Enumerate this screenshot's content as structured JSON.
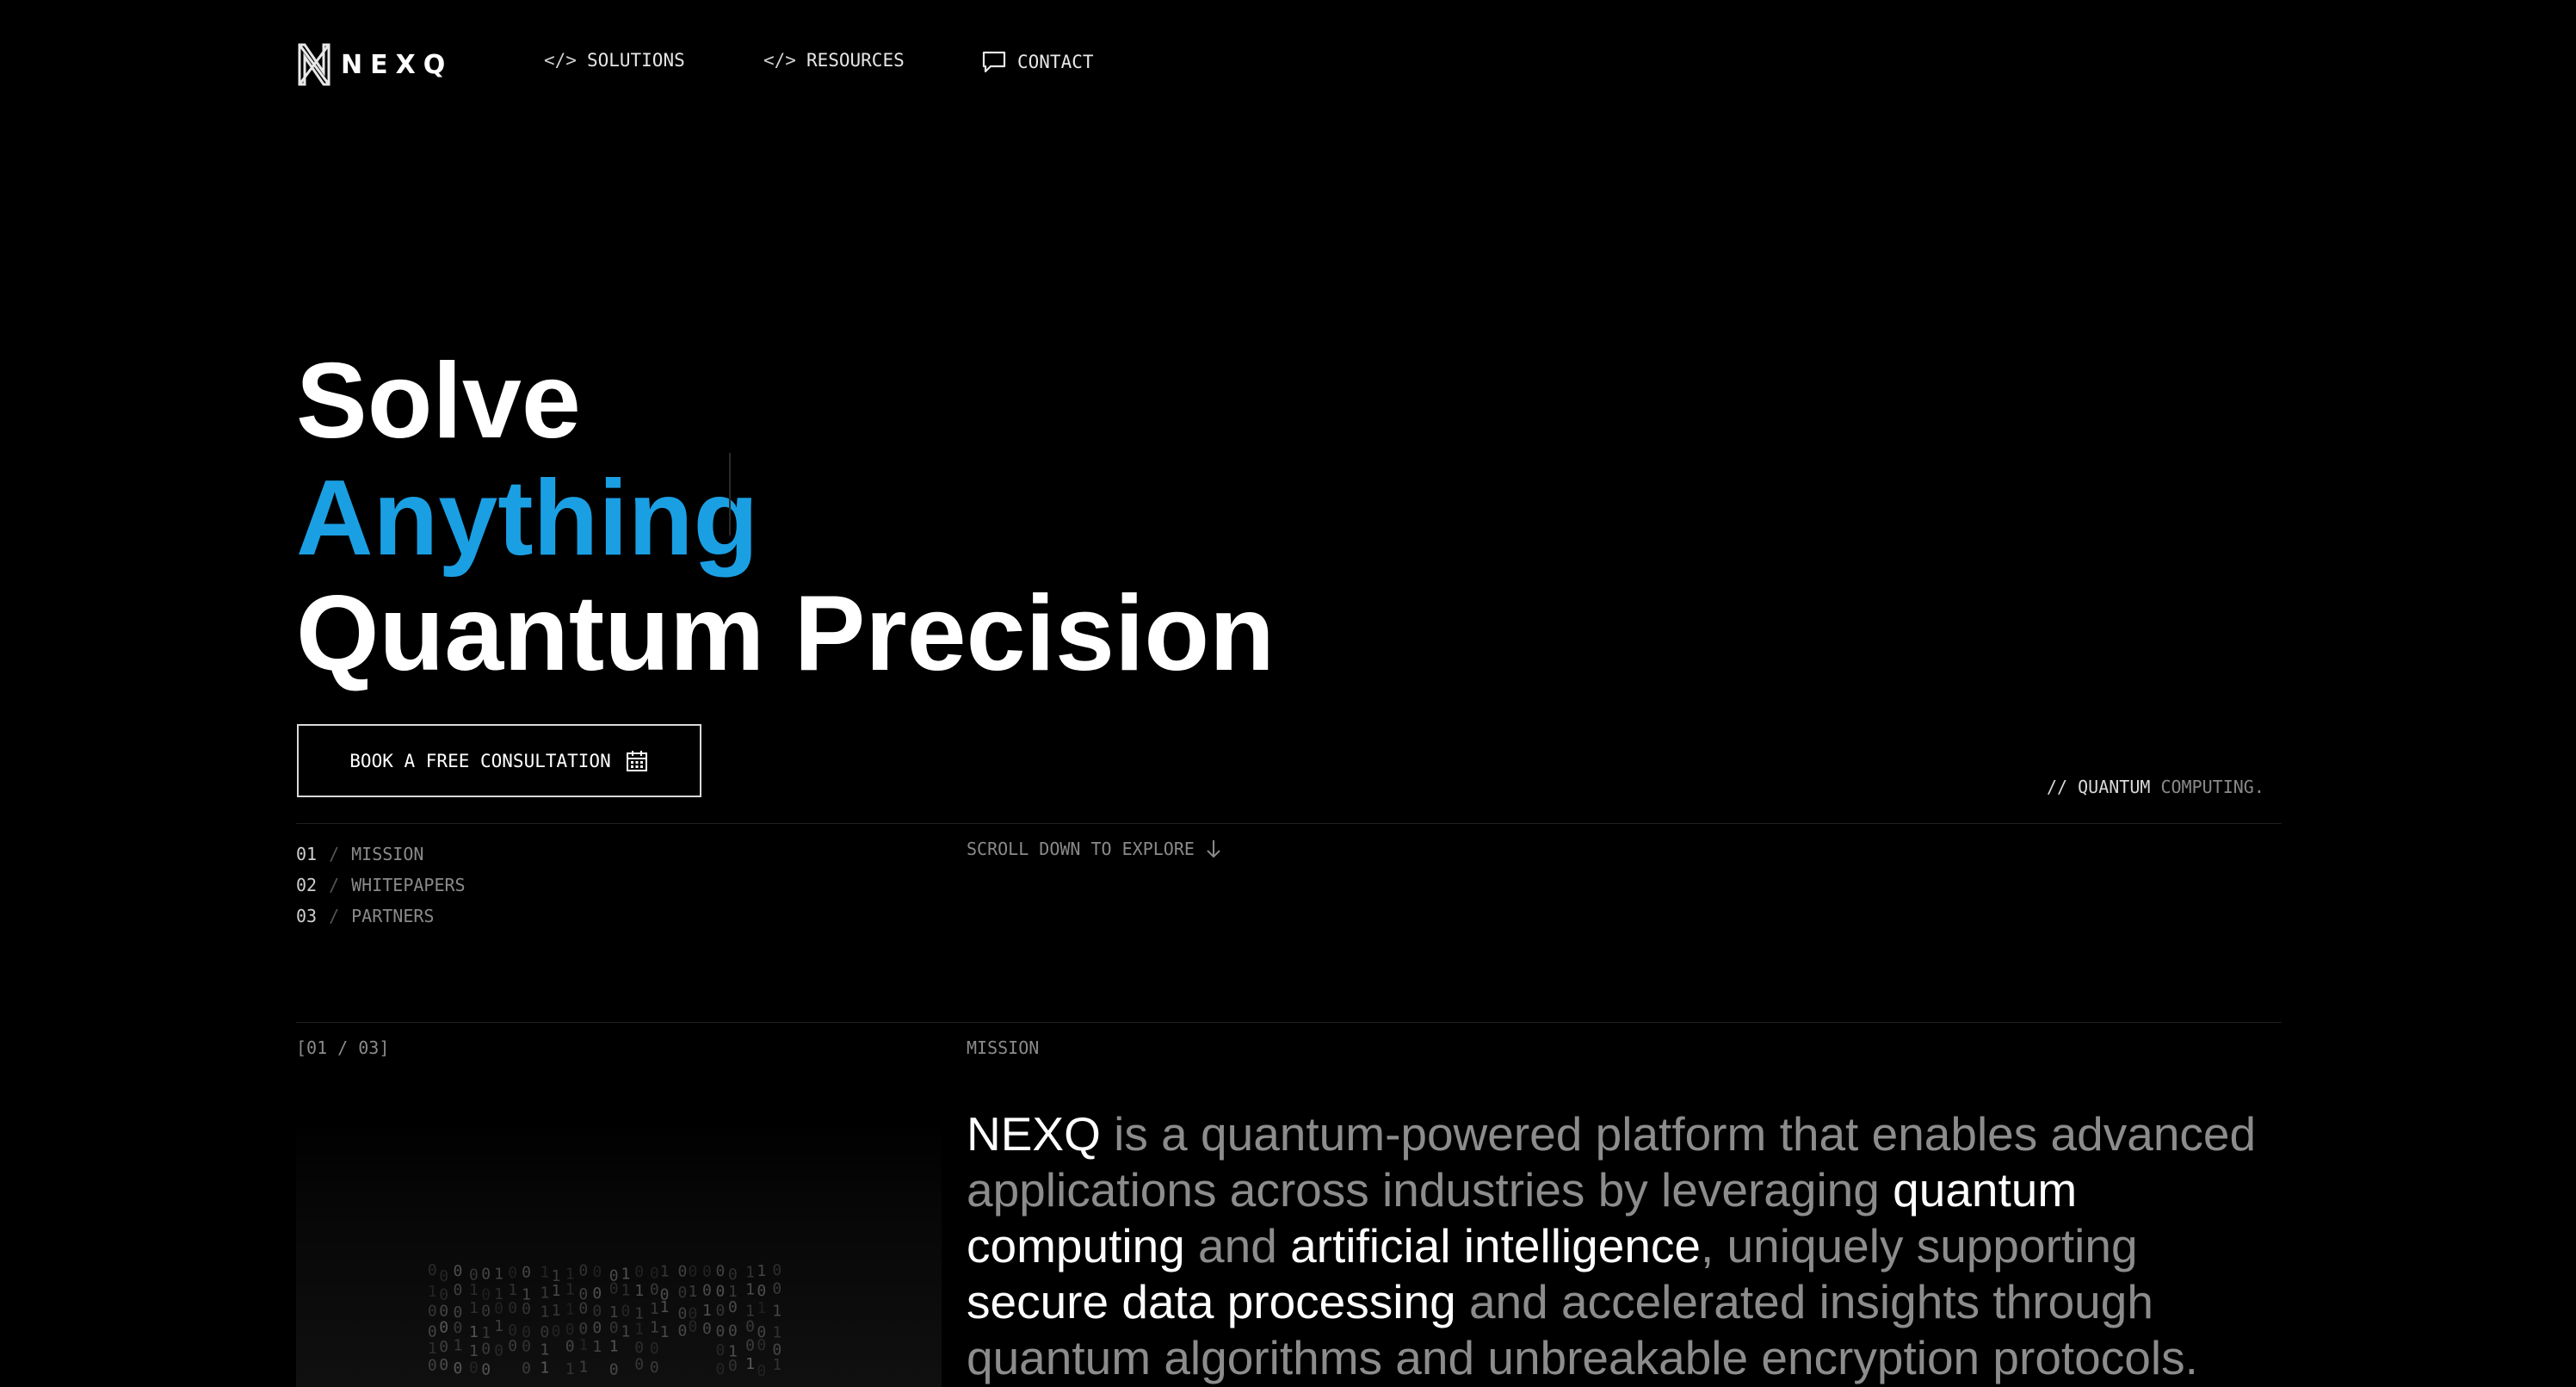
{
  "brand": {
    "name": "NEXQ"
  },
  "nav": {
    "items": [
      {
        "prefix": "</>",
        "label": "SOLUTIONS",
        "icon": "code-icon"
      },
      {
        "prefix": "</>",
        "label": "RESOURCES",
        "icon": "code-icon"
      },
      {
        "label": "CONTACT",
        "icon": "chat-bubble-icon"
      }
    ]
  },
  "hero": {
    "line1": "Solve",
    "line2": "Anything",
    "line3": "Quantum Precision",
    "cta_label": "BOOK A FREE CONSULTATION",
    "cta_icon": "calendar-icon",
    "tagline_prefix": "// QUANTUM",
    "tagline_suffix": "COMPUTING."
  },
  "sections_index": [
    {
      "number": "01",
      "sep": "/",
      "label": "MISSION"
    },
    {
      "number": "02",
      "sep": "/",
      "label": "WHITEPAPERS"
    },
    {
      "number": "03",
      "sep": "/",
      "label": "PARTNERS"
    }
  ],
  "scroll_hint": {
    "label": "SCROLL DOWN TO EXPLORE",
    "icon": "arrow-down-icon"
  },
  "mission": {
    "counter": "[01 / 03]",
    "label": "MISSION",
    "text_parts": [
      {
        "text": "NEXQ",
        "highlight": true
      },
      {
        "text": " is a quantum-powered platform that enables advanced applications across industries by leveraging ",
        "highlight": false
      },
      {
        "text": "quantum computing",
        "highlight": true
      },
      {
        "text": " and ",
        "highlight": false
      },
      {
        "text": "artificial intelligence",
        "highlight": true
      },
      {
        "text": ", uniquely supporting ",
        "highlight": false
      },
      {
        "text": "secure data processing",
        "highlight": true
      },
      {
        "text": " and accelerated insights through quantum algorithms and unbreakable encryption protocols.",
        "highlight": false
      }
    ]
  },
  "colors": {
    "background": "#000000",
    "accent": "#1b9fe3",
    "text_primary": "#ffffff",
    "text_muted": "#8c8c8c"
  }
}
